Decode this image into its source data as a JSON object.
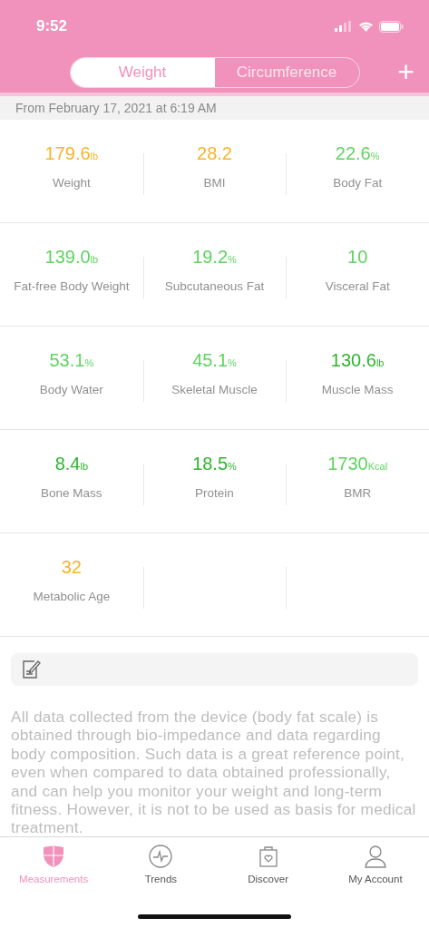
{
  "status_bar": {
    "time": "9:52"
  },
  "segments": [
    {
      "label": "Weight",
      "selected": true
    },
    {
      "label": "Circumference",
      "selected": false
    }
  ],
  "add_button": {
    "label": "+"
  },
  "date": "From February 17, 2021 at 6:19 AM",
  "metrics": [
    {
      "value": "179.6",
      "unit": "lb",
      "name": "Weight",
      "color": "#f7b32b"
    },
    {
      "value": "28.2",
      "name": "BMI",
      "color": "#f7b32b"
    },
    {
      "value": "22.6",
      "unit": "%",
      "name": "Body Fat",
      "color": "#5ed45e"
    },
    {
      "value": "139.0",
      "unit": "lb",
      "name": "Fat-free Body Weight",
      "color": "#5ed45e"
    },
    {
      "value": "19.2",
      "unit": "%",
      "name": "Subcutaneous Fat",
      "color": "#5ed45e"
    },
    {
      "value": "10",
      "name": "Visceral Fat",
      "color": "#5ed45e"
    },
    {
      "value": "53.1",
      "unit": "%",
      "name": "Body Water",
      "color": "#5ed45e"
    },
    {
      "value": "45.1",
      "unit": "%",
      "name": "Skeletal Muscle",
      "color": "#5ed45e"
    },
    {
      "value": "130.6",
      "unit": "lb",
      "name": "Muscle Mass",
      "color": "#2fb52f"
    },
    {
      "value": "8.4",
      "unit": "lb",
      "name": "Bone Mass",
      "color": "#2fb52f"
    },
    {
      "value": "18.5",
      "unit": "%",
      "name": "Protein",
      "color": "#2fb52f"
    },
    {
      "value": "1730",
      "unit": "Kcal",
      "name": "BMR",
      "color": "#5ed45e"
    },
    {
      "value": "32",
      "name": "Metabolic Age",
      "color": "#f7b32b"
    }
  ],
  "disclaimer": "All data collected from the device (body fat scale) is obtained through bio-impedance and data regarding body composition. Such data is a great reference point, even when compared to data obtained professionally, and can help you monitor your weight and long-term fitness. However, it is not to be used as basis for medical treatment.",
  "tab_bar": [
    {
      "label": "Measurements",
      "selected": true
    },
    {
      "label": "Trends",
      "selected": false
    },
    {
      "label": "Discover",
      "selected": false
    },
    {
      "label": "My Account",
      "selected": false
    }
  ]
}
